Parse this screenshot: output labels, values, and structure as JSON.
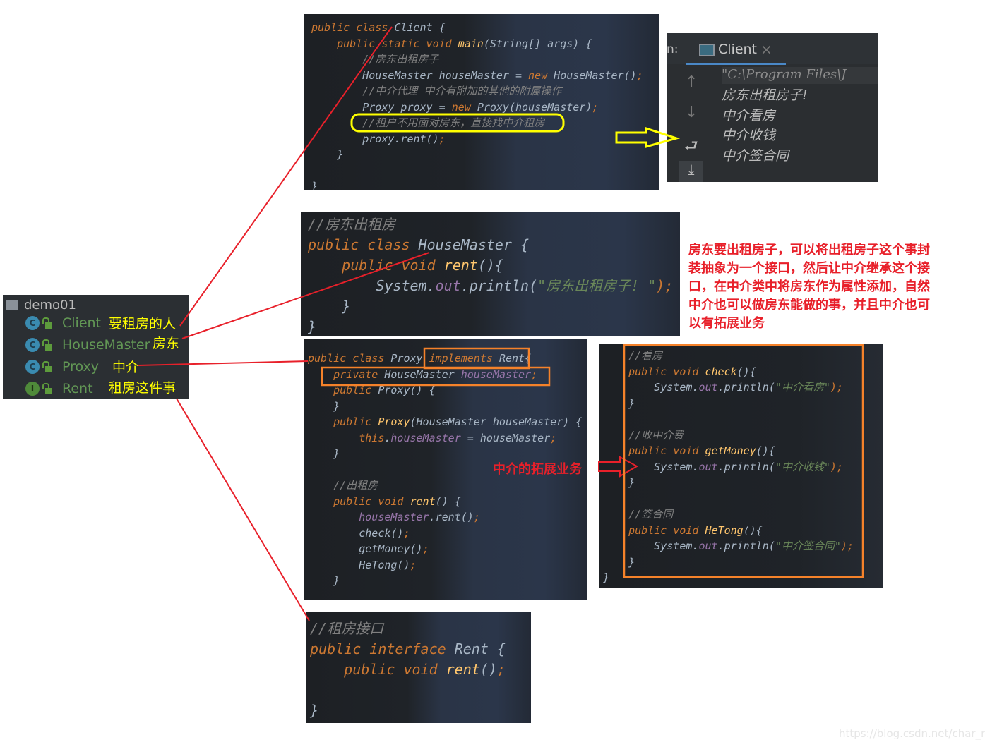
{
  "tree": {
    "project": "demo01",
    "items": [
      {
        "name": "Client",
        "type": "C",
        "label": "要租房的人"
      },
      {
        "name": "HouseMaster",
        "type": "C",
        "label": "房东"
      },
      {
        "name": "Proxy",
        "type": "C",
        "label": "中介"
      },
      {
        "name": "Rent",
        "type": "I",
        "label": "租房这件事"
      }
    ]
  },
  "client": {
    "lines": [
      [
        [
          "public class ",
          "k"
        ],
        [
          "Client {",
          "t"
        ]
      ],
      [
        [
          "    public static void ",
          "k"
        ],
        [
          "main",
          "f"
        ],
        [
          "(String[] args) {",
          "t"
        ]
      ],
      [
        [
          "        //房东出租房子",
          "c"
        ]
      ],
      [
        [
          "        HouseMaster houseMaster = ",
          "t"
        ],
        [
          "new ",
          "k"
        ],
        [
          "HouseMaster()",
          "t"
        ],
        [
          ";",
          "p"
        ]
      ],
      [
        [
          "        //中介代理 中介有附加的其他的附属操作",
          "c"
        ]
      ],
      [
        [
          "        Proxy proxy = ",
          "t"
        ],
        [
          "new ",
          "k"
        ],
        [
          "Proxy(houseMaster)",
          "t"
        ],
        [
          ";",
          "p"
        ]
      ],
      [
        [
          "        //租户不用面对房东，直接找中介租房",
          "c"
        ]
      ],
      [
        [
          "        proxy.rent()",
          "t"
        ],
        [
          ";",
          "p"
        ]
      ],
      [
        [
          "    }",
          "t"
        ]
      ],
      [
        [
          "",
          "t"
        ]
      ],
      [
        [
          "}",
          "t"
        ]
      ]
    ]
  },
  "console": {
    "prefix": "n:",
    "tab": "Client",
    "close": "×",
    "cmd": "\"C:\\Program Files\\J",
    "output": [
      "房东出租房子!",
      "中介看房",
      "中介收钱",
      "中介签合同"
    ]
  },
  "housemaster": {
    "lines": [
      [
        [
          "//房东出租房",
          "c"
        ]
      ],
      [
        [
          "public class ",
          "k"
        ],
        [
          "HouseMaster {",
          "t"
        ]
      ],
      [
        [
          "    public void ",
          "k"
        ],
        [
          "rent",
          "f"
        ],
        [
          "(){",
          "t"
        ]
      ],
      [
        [
          "        System.",
          "t"
        ],
        [
          "out",
          "v"
        ],
        [
          ".println(",
          "t"
        ],
        [
          "\"房东出租房子! \"",
          "s"
        ],
        [
          ");",
          "p"
        ]
      ],
      [
        [
          "    }",
          "t"
        ]
      ],
      [
        [
          "}",
          "t"
        ]
      ]
    ]
  },
  "proxy": {
    "lines": [
      [
        [
          "public class ",
          "k"
        ],
        [
          "Proxy ",
          "t"
        ],
        [
          "implements ",
          "k"
        ],
        [
          "Rent{",
          "t"
        ]
      ],
      [
        [
          "    private ",
          "k"
        ],
        [
          "HouseMaster ",
          "t"
        ],
        [
          "houseMaster",
          "v"
        ],
        [
          ";",
          "p"
        ]
      ],
      [
        [
          "    public ",
          "k"
        ],
        [
          "Proxy",
          "t"
        ],
        [
          "() {",
          "t"
        ]
      ],
      [
        [
          "    }",
          "t"
        ]
      ],
      [
        [
          "    public ",
          "k"
        ],
        [
          "Proxy",
          "f"
        ],
        [
          "(HouseMaster houseMaster) {",
          "t"
        ]
      ],
      [
        [
          "        this",
          "k"
        ],
        [
          ".",
          "t"
        ],
        [
          "houseMaster",
          "v"
        ],
        [
          " = houseMaster",
          "t"
        ],
        [
          ";",
          "p"
        ]
      ],
      [
        [
          "    }",
          "t"
        ]
      ],
      [
        [
          "",
          "t"
        ]
      ],
      [
        [
          "    //出租房",
          "c"
        ]
      ],
      [
        [
          "    public void ",
          "k"
        ],
        [
          "rent",
          "f"
        ],
        [
          "() {",
          "t"
        ]
      ],
      [
        [
          "        houseMaster",
          "v"
        ],
        [
          ".rent()",
          "t"
        ],
        [
          ";",
          "p"
        ]
      ],
      [
        [
          "        check()",
          "t"
        ],
        [
          ";",
          "p"
        ]
      ],
      [
        [
          "        getMoney()",
          "t"
        ],
        [
          ";",
          "p"
        ]
      ],
      [
        [
          "        HeTong()",
          "t"
        ],
        [
          ";",
          "p"
        ]
      ],
      [
        [
          "    }",
          "t"
        ]
      ]
    ]
  },
  "extra": {
    "lines": [
      [
        [
          "    //看房",
          "c"
        ]
      ],
      [
        [
          "    public void ",
          "k"
        ],
        [
          "check",
          "f"
        ],
        [
          "(){",
          "t"
        ]
      ],
      [
        [
          "        System.",
          "t"
        ],
        [
          "out",
          "v"
        ],
        [
          ".println(",
          "t"
        ],
        [
          "\"中介看房\"",
          "s"
        ],
        [
          ");",
          "p"
        ]
      ],
      [
        [
          "    }",
          "t"
        ]
      ],
      [
        [
          "",
          "t"
        ]
      ],
      [
        [
          "    //收中介费",
          "c"
        ]
      ],
      [
        [
          "    public void ",
          "k"
        ],
        [
          "getMoney",
          "f"
        ],
        [
          "(){",
          "t"
        ]
      ],
      [
        [
          "        System.",
          "t"
        ],
        [
          "out",
          "v"
        ],
        [
          ".println(",
          "t"
        ],
        [
          "\"中介收钱\"",
          "s"
        ],
        [
          ");",
          "p"
        ]
      ],
      [
        [
          "    }",
          "t"
        ]
      ],
      [
        [
          "",
          "t"
        ]
      ],
      [
        [
          "    //签合同",
          "c"
        ]
      ],
      [
        [
          "    public void ",
          "k"
        ],
        [
          "HeTong",
          "f"
        ],
        [
          "(){",
          "t"
        ]
      ],
      [
        [
          "        System.",
          "t"
        ],
        [
          "out",
          "v"
        ],
        [
          ".println(",
          "t"
        ],
        [
          "\"中介签合同\"",
          "s"
        ],
        [
          ");",
          "p"
        ]
      ],
      [
        [
          "    }",
          "t"
        ]
      ],
      [
        [
          "}",
          "t"
        ]
      ]
    ]
  },
  "rent": {
    "lines": [
      [
        [
          "//租房接口",
          "c"
        ]
      ],
      [
        [
          "public interface ",
          "k"
        ],
        [
          "Rent {",
          "t"
        ]
      ],
      [
        [
          "    public void ",
          "k"
        ],
        [
          "rent",
          "f"
        ],
        [
          "()",
          "t"
        ],
        [
          ";",
          "p"
        ]
      ],
      [
        [
          "",
          "t"
        ]
      ],
      [
        [
          "}",
          "t"
        ]
      ]
    ]
  },
  "annotations": {
    "explanation": [
      "房东要出租房子，可以将出租房子这个事封",
      "装抽象为一个接口，然后让中介继承这个接",
      "口，在中介类中将房东作为属性添加，自然",
      "中介也可以做房东能做的事，并且中介也可",
      "以有拓展业务"
    ],
    "extension": "中介的拓展业务"
  },
  "watermark": "https://blog.csdn.net/char_m",
  "colors": {
    "connector": "#e8202a",
    "highlight_yellow": "#ffff00",
    "highlight_orange": "#f5822a"
  }
}
